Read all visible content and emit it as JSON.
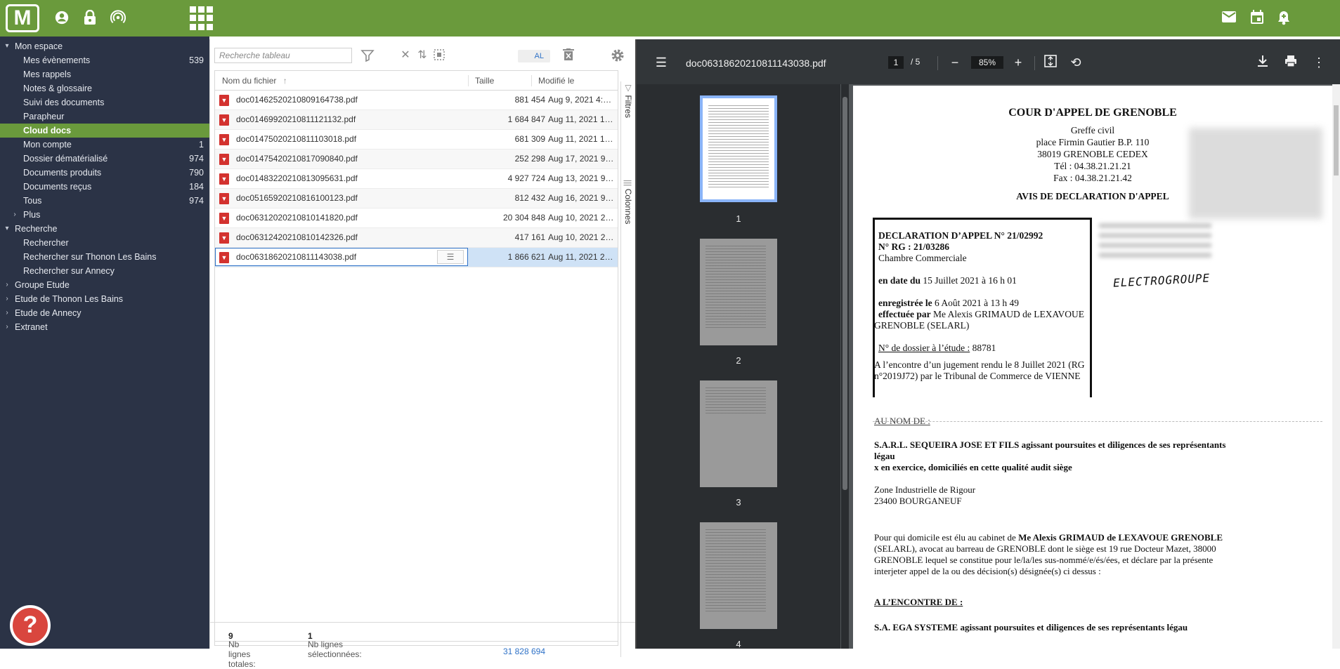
{
  "topbar": {
    "logo_text": "M",
    "left_icons": [
      "user-circle-icon",
      "lock-icon",
      "broadcast-icon"
    ],
    "right_icons": [
      "mail-icon",
      "calendar-icon",
      "bell-plus-icon"
    ]
  },
  "sidebar": {
    "items": [
      {
        "label": "Mon espace",
        "count": "",
        "arrow": "▾",
        "level": 0
      },
      {
        "label": "Mes évènements",
        "count": "539",
        "arrow": "",
        "level": 1
      },
      {
        "label": "Mes rappels",
        "count": "",
        "arrow": "",
        "level": 1
      },
      {
        "label": "Notes & glossaire",
        "count": "",
        "arrow": "",
        "level": 1
      },
      {
        "label": "Suivi des documents",
        "count": "",
        "arrow": "",
        "level": 1
      },
      {
        "label": "Parapheur",
        "count": "",
        "arrow": "",
        "level": 1
      },
      {
        "label": "Cloud docs",
        "count": "",
        "arrow": "",
        "level": 1,
        "active": true
      },
      {
        "label": "Mon compte",
        "count": "1",
        "arrow": "",
        "level": 1
      },
      {
        "label": "Dossier dématérialisé",
        "count": "974",
        "arrow": "",
        "level": 1
      },
      {
        "label": "Documents produits",
        "count": "790",
        "arrow": "",
        "level": 1
      },
      {
        "label": "Documents reçus",
        "count": "184",
        "arrow": "",
        "level": 1
      },
      {
        "label": "Tous",
        "count": "974",
        "arrow": "",
        "level": 1
      },
      {
        "label": "Plus",
        "count": "",
        "arrow": "›",
        "level": 1
      },
      {
        "label": "Recherche",
        "count": "",
        "arrow": "▾",
        "level": 0
      },
      {
        "label": "Rechercher",
        "count": "",
        "arrow": "",
        "level": 1
      },
      {
        "label": "Rechercher sur Thonon Les Bains",
        "count": "",
        "arrow": "",
        "level": 1
      },
      {
        "label": "Rechercher sur Annecy",
        "count": "",
        "arrow": "",
        "level": 1
      },
      {
        "label": "Groupe Etude",
        "count": "",
        "arrow": "›",
        "level": 0
      },
      {
        "label": "Etude de Thonon Les Bains",
        "count": "",
        "arrow": "›",
        "level": 0
      },
      {
        "label": "Etude de Annecy",
        "count": "",
        "arrow": "›",
        "level": 0
      },
      {
        "label": "Extranet",
        "count": "",
        "arrow": "›",
        "level": 0
      }
    ],
    "help_label": "?"
  },
  "table": {
    "search_placeholder": "Recherche tableau",
    "al_label": "AL",
    "columns": {
      "name": "Nom du fichier",
      "size": "Taille",
      "modified": "Modifié le",
      "sort_indicator": "↑"
    },
    "rows": [
      {
        "name": "doc01462520210809164738.pdf",
        "size": "881 454",
        "date": "Aug 9, 2021 4:47:..."
      },
      {
        "name": "doc01469920210811121132.pdf",
        "size": "1 684 847",
        "date": "Aug 11, 2021 12:..."
      },
      {
        "name": "doc01475020210811103018.pdf",
        "size": "681 309",
        "date": "Aug 11, 2021 10:..."
      },
      {
        "name": "doc01475420210817090840.pdf",
        "size": "252 298",
        "date": "Aug 17, 2021 9:0..."
      },
      {
        "name": "doc01483220210813095631.pdf",
        "size": "4 927 724",
        "date": "Aug 13, 2021 9:5..."
      },
      {
        "name": "doc05165920210816100123.pdf",
        "size": "812 432",
        "date": "Aug 16, 2021 9:5..."
      },
      {
        "name": "doc06312020210810141820.pdf",
        "size": "20 304 848",
        "date": "Aug 10, 2021 2:1..."
      },
      {
        "name": "doc06312420210810142326.pdf",
        "size": "417 161",
        "date": "Aug 10, 2021 2:1..."
      },
      {
        "name": "doc06318620210811143038.pdf",
        "size": "1 866 621",
        "date": "Aug 11, 2021 2:2...",
        "selected": true
      }
    ],
    "total_size": "31 828 694",
    "side_tabs": {
      "filters": "Filtres",
      "columns": "Colonnes"
    },
    "status": {
      "total_label": "Nb lignes totales:",
      "total_value": "9",
      "selected_label": "Nb lignes sélectionnées:",
      "selected_value": "1"
    }
  },
  "viewer": {
    "file_name": "doc06318620210811143038.pdf",
    "page_current": "1",
    "page_total": "/ 5",
    "zoom": "85%",
    "thumb_numbers": [
      "1",
      "2",
      "3",
      "4"
    ],
    "doc": {
      "court": "COUR D'APPEL DE GRENOBLE",
      "greffe": "Greffe civil",
      "address1": "place Firmin Gautier B.P. 110",
      "address2": "38019 GRENOBLE CEDEX",
      "tel": "Tél : 04.38.21.21.21",
      "fax": "Fax : 04.38.21.21.42",
      "notice": "AVIS DE DECLARATION D'APPEL",
      "decl_no": "DECLARATION D’APPEL N° 21/02992",
      "rg": "N° RG :  21/03286",
      "chamber": "Chambre Commerciale",
      "date_label": "en date du",
      "date_value": "15 Juillet 2021 à 16 h 01",
      "reg_label": "enregistrée le",
      "reg_value": "6 Août 2021 à 13 h 49",
      "by_label": "effectuée par",
      "by_value": "Me Alexis GRIMAUD de LEXAVOUE",
      "by_value2": "GRENOBLE (SELARL)",
      "dossier_label": "N° de dossier à l’étude :",
      "dossier_value": "88781",
      "against1": "A l’encontre d’un jugement rendu le 8 Juillet 2021 (RG",
      "against2": "n°2019J72) par le Tribunal de Commerce de VIENNE",
      "handwritten": "ELECTROGROUPE",
      "au_nom": "AU NOM DE :",
      "party1": "S.A.R.L. SEQUEIRA JOSE ET FILS agissant poursuites et diligences de ses représentants",
      "party1b": "légau",
      "party1c": "x en exercice, domiciliés en cette qualité audit siège",
      "zone": "Zone Industrielle de Rigour",
      "city": "23400 BOURGANEUF",
      "para1_pre": "Pour qui domicile est élu au cabinet de",
      "para1_bold": "Me Alexis GRIMAUD de LEXAVOUE GRENOBLE",
      "para2": "(SELARL), avocat au barreau de GRENOBLE dont le siège est 19 rue Docteur Mazet, 38000",
      "para3": "GRENOBLE lequel se constitue pour le/la/les sus-nommé/e/és/ées, et déclare par la présente",
      "para4": "interjeter appel de la ou des décision(s) désignée(s) ci dessus :",
      "a_lencontre": "A L’ENCONTRE DE :",
      "party2": "S.A. EGA SYSTEME agissant poursuites et diligences de ses représentants légau"
    }
  }
}
